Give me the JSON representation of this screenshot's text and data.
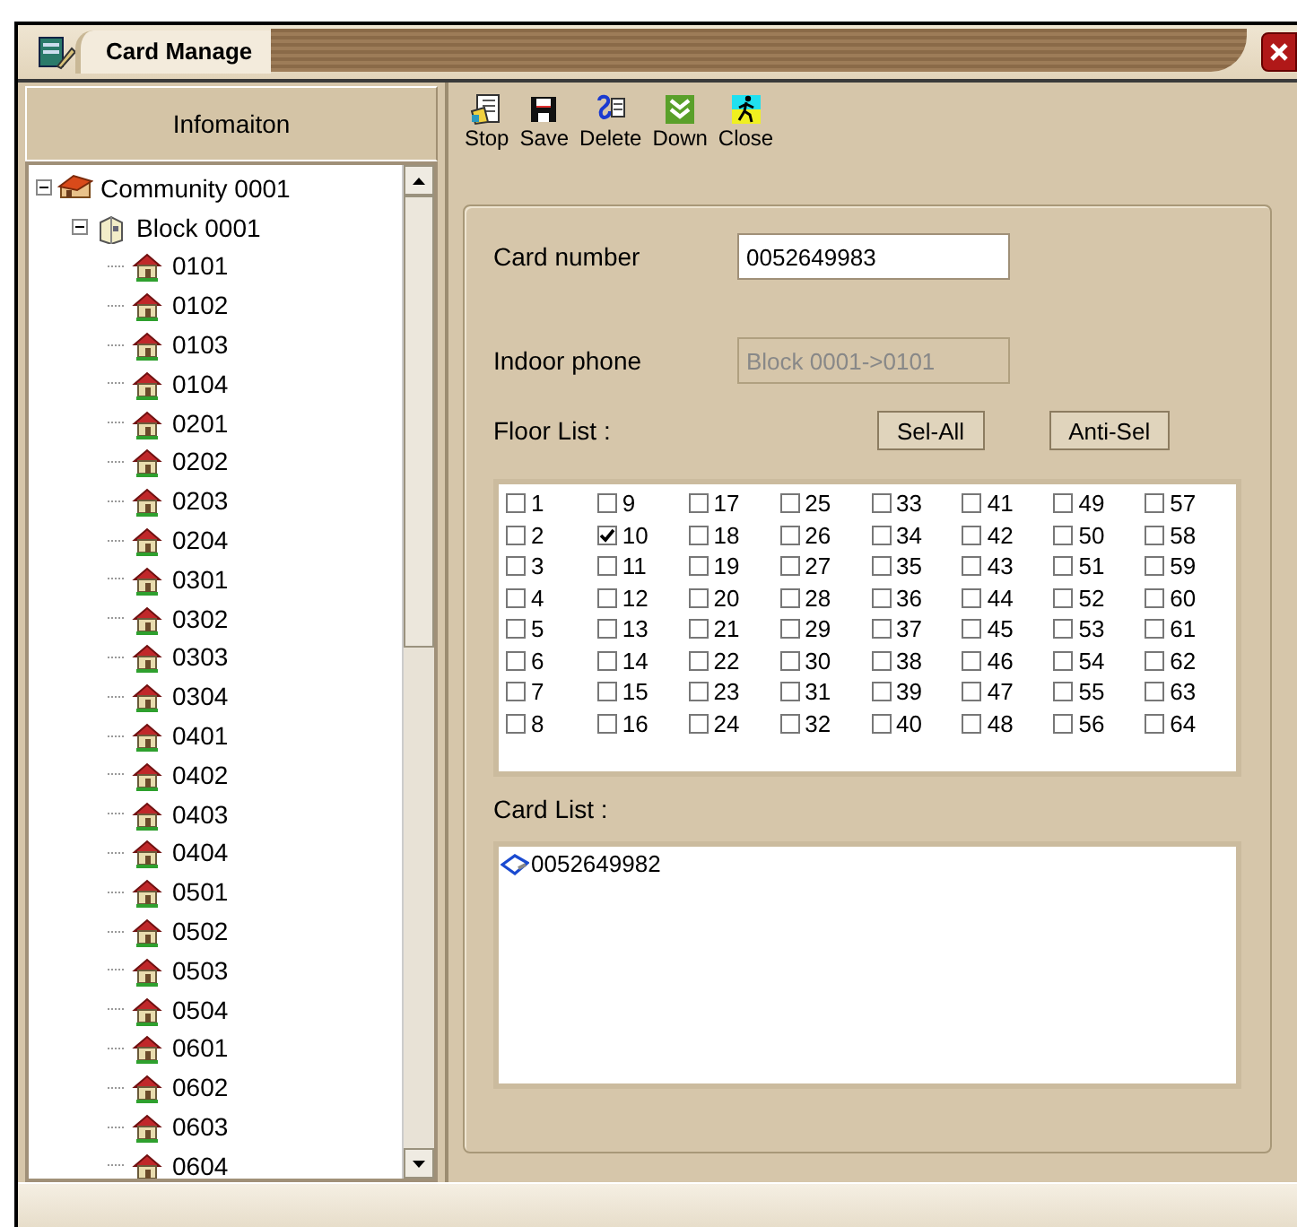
{
  "window": {
    "title": "Card Manage"
  },
  "sidebar": {
    "header": "Infomaiton",
    "tree": [
      {
        "label": "Community 0001",
        "kind": "community",
        "expanded": true,
        "children": [
          {
            "label": "Block  0001",
            "kind": "block",
            "expanded": true,
            "children": [
              {
                "label": "0101",
                "kind": "room"
              },
              {
                "label": "0102",
                "kind": "room"
              },
              {
                "label": "0103",
                "kind": "room"
              },
              {
                "label": "0104",
                "kind": "room"
              },
              {
                "label": "0201",
                "kind": "room"
              },
              {
                "label": "0202",
                "kind": "room"
              },
              {
                "label": "0203",
                "kind": "room"
              },
              {
                "label": "0204",
                "kind": "room"
              },
              {
                "label": "0301",
                "kind": "room"
              },
              {
                "label": "0302",
                "kind": "room"
              },
              {
                "label": "0303",
                "kind": "room"
              },
              {
                "label": "0304",
                "kind": "room"
              },
              {
                "label": "0401",
                "kind": "room"
              },
              {
                "label": "0402",
                "kind": "room"
              },
              {
                "label": "0403",
                "kind": "room"
              },
              {
                "label": "0404",
                "kind": "room"
              },
              {
                "label": "0501",
                "kind": "room"
              },
              {
                "label": "0502",
                "kind": "room"
              },
              {
                "label": "0503",
                "kind": "room"
              },
              {
                "label": "0504",
                "kind": "room"
              },
              {
                "label": "0601",
                "kind": "room"
              },
              {
                "label": "0602",
                "kind": "room"
              },
              {
                "label": "0603",
                "kind": "room"
              },
              {
                "label": "0604",
                "kind": "room"
              }
            ]
          }
        ]
      }
    ]
  },
  "toolbar": [
    {
      "label": "Stop",
      "kind": "stop"
    },
    {
      "label": "Save",
      "kind": "save"
    },
    {
      "label": "Delete",
      "kind": "delete"
    },
    {
      "label": "Down",
      "kind": "down"
    },
    {
      "label": "Close",
      "kind": "close"
    }
  ],
  "form": {
    "card_number": {
      "label": "Card number",
      "value": "0052649983"
    },
    "indoor_phone": {
      "label": "Indoor phone",
      "value": "Block 0001->0101",
      "disabled": true
    },
    "floor_list": {
      "label": "Floor List :",
      "buttons": [
        "Sel-All",
        "Anti-Sel"
      ],
      "floors": [
        {
          "label": "1",
          "checked": false
        },
        {
          "label": "2",
          "checked": false
        },
        {
          "label": "3",
          "checked": false
        },
        {
          "label": "4",
          "checked": false
        },
        {
          "label": "5",
          "checked": false
        },
        {
          "label": "6",
          "checked": false
        },
        {
          "label": "7",
          "checked": false
        },
        {
          "label": "8",
          "checked": false
        },
        {
          "label": "9",
          "checked": false
        },
        {
          "label": "10",
          "checked": true
        },
        {
          "label": "11",
          "checked": false
        },
        {
          "label": "12",
          "checked": false
        },
        {
          "label": "13",
          "checked": false
        },
        {
          "label": "14",
          "checked": false
        },
        {
          "label": "15",
          "checked": false
        },
        {
          "label": "16",
          "checked": false
        },
        {
          "label": "17",
          "checked": false
        },
        {
          "label": "18",
          "checked": false
        },
        {
          "label": "19",
          "checked": false
        },
        {
          "label": "20",
          "checked": false
        },
        {
          "label": "21",
          "checked": false
        },
        {
          "label": "22",
          "checked": false
        },
        {
          "label": "23",
          "checked": false
        },
        {
          "label": "24",
          "checked": false
        },
        {
          "label": "25",
          "checked": false
        },
        {
          "label": "26",
          "checked": false
        },
        {
          "label": "27",
          "checked": false
        },
        {
          "label": "28",
          "checked": false
        },
        {
          "label": "29",
          "checked": false
        },
        {
          "label": "30",
          "checked": false
        },
        {
          "label": "31",
          "checked": false
        },
        {
          "label": "32",
          "checked": false
        },
        {
          "label": "33",
          "checked": false
        },
        {
          "label": "34",
          "checked": false
        },
        {
          "label": "35",
          "checked": false
        },
        {
          "label": "36",
          "checked": false
        },
        {
          "label": "37",
          "checked": false
        },
        {
          "label": "38",
          "checked": false
        },
        {
          "label": "39",
          "checked": false
        },
        {
          "label": "40",
          "checked": false
        },
        {
          "label": "41",
          "checked": false
        },
        {
          "label": "42",
          "checked": false
        },
        {
          "label": "43",
          "checked": false
        },
        {
          "label": "44",
          "checked": false
        },
        {
          "label": "45",
          "checked": false
        },
        {
          "label": "46",
          "checked": false
        },
        {
          "label": "47",
          "checked": false
        },
        {
          "label": "48",
          "checked": false
        },
        {
          "label": "49",
          "checked": false
        },
        {
          "label": "50",
          "checked": false
        },
        {
          "label": "51",
          "checked": false
        },
        {
          "label": "52",
          "checked": false
        },
        {
          "label": "53",
          "checked": false
        },
        {
          "label": "54",
          "checked": false
        },
        {
          "label": "55",
          "checked": false
        },
        {
          "label": "56",
          "checked": false
        },
        {
          "label": "57",
          "checked": false
        },
        {
          "label": "58",
          "checked": false
        },
        {
          "label": "59",
          "checked": false
        },
        {
          "label": "60",
          "checked": false
        },
        {
          "label": "61",
          "checked": false
        },
        {
          "label": "62",
          "checked": false
        },
        {
          "label": "63",
          "checked": false
        },
        {
          "label": "64",
          "checked": false
        }
      ]
    },
    "card_list": {
      "label": "Card  List :",
      "items": [
        "0052649982"
      ]
    }
  }
}
